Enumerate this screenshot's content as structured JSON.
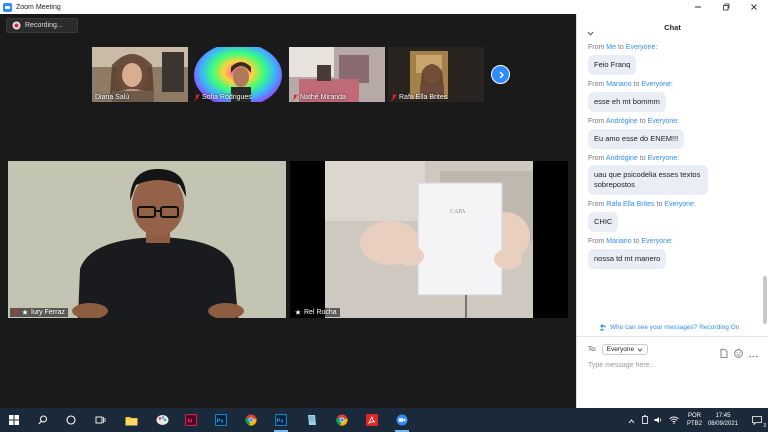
{
  "window": {
    "title": "Zoom Meeting"
  },
  "recording": {
    "label": "Recording..."
  },
  "strip": [
    {
      "name": "Diana Salú"
    },
    {
      "name": "Sofia Rodrigues"
    },
    {
      "name": "Nathé Miranda"
    },
    {
      "name": "Rafa Ella Brites"
    }
  ],
  "tiles": [
    {
      "name": "Iury Ferraz"
    },
    {
      "name": "Rel Rocha",
      "card_text": "CAPA"
    }
  ],
  "chat": {
    "title": "Chat",
    "from_word": "From",
    "to_word": "to",
    "messages": [
      {
        "from": "Me",
        "to": "Everyone",
        "text": "Feio Franq"
      },
      {
        "from": "Mariano",
        "to": "Everyone",
        "text": "esse eh mt bommm"
      },
      {
        "from": "Andrógine",
        "to": "Everyone",
        "text": "Eu amo esse do ENEM!!!"
      },
      {
        "from": "Andrógine",
        "to": "Everyone",
        "text": "uau que psicodelia esses textos sobrepostos"
      },
      {
        "from": "Rafa Ella Brites",
        "to": "Everyone",
        "text": "CHIC"
      },
      {
        "from": "Mariano",
        "to": "Everyone",
        "text": "nossa td mt manero"
      }
    ],
    "who_sees": "Who can see your messages? Recording On",
    "to_label": "To:",
    "to_value": "Everyone",
    "placeholder": "Type message here..."
  },
  "taskbar": {
    "lang_line1": "POR",
    "lang_line2": "PTB2",
    "time": "17:45",
    "date": "08/09/2021",
    "notif_count": "3"
  },
  "colors": {
    "accent": "#2d8cff",
    "chat_bubble": "#e9eef6",
    "taskbar": "#1b2a3a"
  }
}
